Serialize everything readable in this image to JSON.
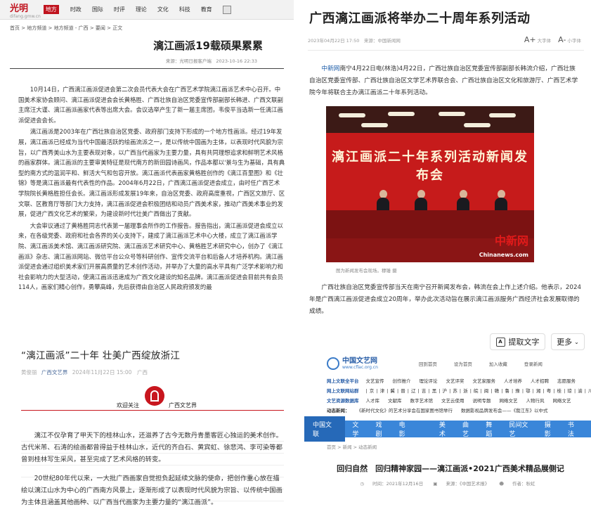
{
  "gmw": {
    "logo": "光明",
    "logo_sub": "difang.gmw.cn",
    "local_badge": "地方",
    "nav": [
      "时政",
      "国际",
      "时评",
      "理论",
      "文化",
      "科技",
      "教育"
    ],
    "breadcrumb": "首页 > 地方频道 > 地方频道 - 广西 > 要闻 > 正文",
    "title": "漓江画派19载硕果累累",
    "meta": "来源：光明日报客户端　2023-10-16 22:33",
    "paragraphs": [
      "10月14日，广西漓江画派促进会第二次会员代表大会在广西艺术学院漓江画派艺术中心召开。中国美术家协会顾问、漓江画派促进会会长黄格胜、广西壮族自治区党委宣传部副部长韩进、广西文联副主席汪大谨、漓江画派画家代表等出席大会。会议选举产生了新一届主席团，韦俊平当选新一任漓江画派促进会会长。",
      "漓江画派是2003年在广西壮族自治区党委、政府部门支持下形成的一个地方性画派。经过19年发展，漓江画派已经成为当代中国最活跃的绘画流派之一，是以传统中国画为主体，以表现时代风貌为宗旨，以广西秀美山水为主要表现对象，以广西当代画家为主要力量，具有共同理想追求和鲜明艺术风格的画家群体。漓江画派的主要审美特征是现代南方的新田园诗画风，作品本都以'景与生为基础，具有典型的南方式的温润平和、鲜活大气和包容开放。漓江画派代表画家黄格胜创作的《漓江百里图》和《壮锦》等是漓江画派最有代表性的作品。2004年6月22日，广西漓江画派促进会成立，由时任广西艺术学院院长黄格胜担任会长。漓江画派形成发展19年来，自治区党委、政府高度重视，广西区文旅厅、区文联、区教育厅等部门大力支持，漓江画派促进会积极团结和动员广西美术家，推动广西美术事业的发展，促进广西文化艺术的繁荣，为建设新时代壮美广西做出了贡献。",
      "大会审议通过了黄格胜同志代表第一届理事会所作的工作报告。报告指出，漓江画派促进会成立以来，在各级党委、政府和社会各界的关心支持下，建成了漓江画派艺术中心大楼，成立了漓江画派学院、漓江画派美术馆、漓江画派研究院、漓江画派艺术研究中心、黄格胜艺术研究中心，创办了《漓江画派》杂志、漓江画派网站、微信平台公众号等科研创作、宣传交流平台和后备人才培养机构。漓江画派促进会通过组织美术家们开展高质量的艺术创作活动，并举办了大量的高水平具有广泛学术影响力和社会影响力的大型活动，使漓江画派迅速成为广西文化建设的知名品牌。漓江画派促进会目前共有会员114人，画家们精心创作，勇攀高峰，先后获得由自治区人民政府颁发的最"
    ]
  },
  "cns": {
    "title": "广西漓江画派将举办二十周年系列活动",
    "meta": "2023年04月22日 17:50　来源：中国新闻网",
    "font_large": "大字体",
    "font_small": "小字体",
    "lead_source": "中新网",
    "lead_text": "南宁4月22日电(林浩)4月22日，广西壮族自治区党委宣传部副部长韩流介绍，广西壮族自治区党委宣传部、广西壮族自治区文学艺术界联合会、广西壮族自治区文化和旅游厅、广西艺术学院今年将联合主办漓江画派二十年系列活动。",
    "photo_banner": "漓江画派二十年系列活动新闻发布会",
    "photo_watermark": "中新网",
    "photo_watermark_url": "Chinanews.com",
    "photo_caption": "图为新闻发布会现场。穆锤 摄",
    "para2": "广西壮族自治区党委宣传部当天在南宁召开新闻发布会，韩流在会上作上述介绍。他表示，2024年是广西漓江画派促进会成立20周年，举办此次活动旨在展示漓江画派服务广西经济社会发展取得的成绩。"
  },
  "toolbar": {
    "extract_icon": "A",
    "extract_label": "提取文字",
    "more_label": "更多"
  },
  "gxwy": {
    "title": "“漓江画派”二十年 壮美广西绽放浙江",
    "author": "黄俊丽",
    "account": "广西文艺界",
    "date": "2024年11月22日 15:00　广西",
    "follow_left": "欢迎关注",
    "follow_right": "广西文艺界",
    "paragraphs": [
      "漓江不仅孕育了甲天下的桂林山水，还滋养了古今无数丹青墨客匠心独运的美术创作。古代米芾、石涛的绘画都曾得益于桂林山水，近代的齐白石、黄宾虹、徐悲鸿、李可染等都曾到桂林写生采风，甚至完成了艺术风格的转变。",
      "20世纪80年代以来，一大批广西画家自觉担负起延续文脉的使命，把创作重心放在描绘以漓江山水为中心的广西南方风景上，逐渐形成了以表现时代风貌为宗旨、以传统中国画为主体且涵盖其他画种、以广西当代画家为主要力量的“漓江画派”。"
    ]
  },
  "cflac": {
    "site_name": "中国文艺网",
    "site_url": "www.cflac.org.cn",
    "top_links": [
      "回到首页",
      "设为首页",
      "加入收藏",
      "登录新闻"
    ],
    "row1_label": "网上文联全平台",
    "row1": [
      "文艺宣传",
      "创作推介",
      "理论评论",
      "文艺评奖",
      "文艺家服务",
      "人才培养",
      "人才招聘",
      "志愿服务"
    ],
    "row2_label": "网上文联网站群",
    "row2": "| 京 | 津 | 冀 | 晋 | 辽 | 吉 | 黑 | 沪 | 苏 | 浙 | 皖 | 闽 | 赣 | 鲁 | 豫 | 鄂 | 湘 | 粤 | 桂 | 琼 | 渝 | 川 | 贵",
    "row3_label": "文艺资源数据库",
    "row3": [
      "人才库",
      "文献库",
      "数字艺术馆",
      "文艺云使用",
      "说明专题",
      "网络文艺",
      "人物行风",
      "网络文艺"
    ],
    "row4_label": "动态新闻：",
    "row4": [
      "《新时代文化》的艺术分享会在国家图书馆举行",
      "数据影视品牌发布会——《我江东》以中式"
    ],
    "nav": [
      "中国文联",
      "文学",
      "戏剧",
      "电影",
      "美术",
      "曲艺",
      "舞蹈",
      "民间文艺",
      "摄影",
      "书法"
    ],
    "breadcrumb": "首页 > 新闻 > 动态新闻",
    "title": "回归自然　回归精神家园——漓江画派•2021广西美术精品展侧记",
    "meta_time": "时间：2021年12月16日",
    "meta_source": "来源：《中国艺术报》",
    "meta_author": "作者：秋虹"
  }
}
